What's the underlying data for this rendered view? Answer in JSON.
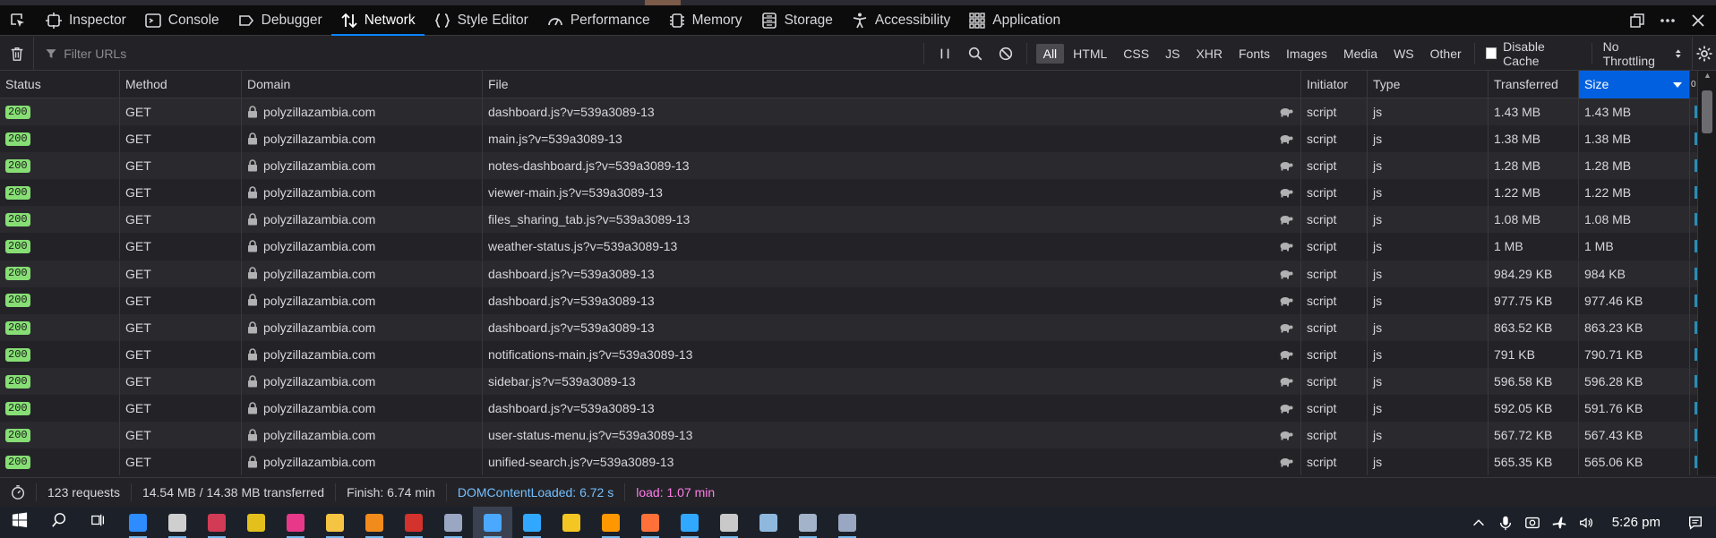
{
  "toolbar": {
    "tabs": [
      {
        "label": "Inspector",
        "icon": "inspector-icon"
      },
      {
        "label": "Console",
        "icon": "console-icon"
      },
      {
        "label": "Debugger",
        "icon": "debugger-icon"
      },
      {
        "label": "Network",
        "icon": "network-icon",
        "selected": true
      },
      {
        "label": "Style Editor",
        "icon": "style-editor-icon"
      },
      {
        "label": "Performance",
        "icon": "performance-icon"
      },
      {
        "label": "Memory",
        "icon": "memory-icon"
      },
      {
        "label": "Storage",
        "icon": "storage-icon"
      },
      {
        "label": "Accessibility",
        "icon": "accessibility-icon"
      },
      {
        "label": "Application",
        "icon": "application-icon"
      }
    ]
  },
  "filterbar": {
    "placeholder": "Filter URLs",
    "types": [
      "All",
      "HTML",
      "CSS",
      "JS",
      "XHR",
      "Fonts",
      "Images",
      "Media",
      "WS",
      "Other"
    ],
    "active_type": "All",
    "disable_cache_label": "Disable Cache",
    "throttling_label": "No Throttling"
  },
  "columns": {
    "status": "Status",
    "method": "Method",
    "domain": "Domain",
    "file": "File",
    "initiator": "Initiator",
    "type": "Type",
    "transferred": "Transferred",
    "size": "Size",
    "waterfall": "0"
  },
  "requests": [
    {
      "status": "200",
      "method": "GET",
      "domain": "polyzillazambia.com",
      "file": "dashboard.js?v=539a3089-13",
      "initiator": "script",
      "type": "js",
      "transferred": "1.43 MB",
      "size": "1.43 MB"
    },
    {
      "status": "200",
      "method": "GET",
      "domain": "polyzillazambia.com",
      "file": "main.js?v=539a3089-13",
      "initiator": "script",
      "type": "js",
      "transferred": "1.38 MB",
      "size": "1.38 MB"
    },
    {
      "status": "200",
      "method": "GET",
      "domain": "polyzillazambia.com",
      "file": "notes-dashboard.js?v=539a3089-13",
      "initiator": "script",
      "type": "js",
      "transferred": "1.28 MB",
      "size": "1.28 MB"
    },
    {
      "status": "200",
      "method": "GET",
      "domain": "polyzillazambia.com",
      "file": "viewer-main.js?v=539a3089-13",
      "initiator": "script",
      "type": "js",
      "transferred": "1.22 MB",
      "size": "1.22 MB"
    },
    {
      "status": "200",
      "method": "GET",
      "domain": "polyzillazambia.com",
      "file": "files_sharing_tab.js?v=539a3089-13",
      "initiator": "script",
      "type": "js",
      "transferred": "1.08 MB",
      "size": "1.08 MB"
    },
    {
      "status": "200",
      "method": "GET",
      "domain": "polyzillazambia.com",
      "file": "weather-status.js?v=539a3089-13",
      "initiator": "script",
      "type": "js",
      "transferred": "1 MB",
      "size": "1 MB"
    },
    {
      "status": "200",
      "method": "GET",
      "domain": "polyzillazambia.com",
      "file": "dashboard.js?v=539a3089-13",
      "initiator": "script",
      "type": "js",
      "transferred": "984.29 KB",
      "size": "984 KB"
    },
    {
      "status": "200",
      "method": "GET",
      "domain": "polyzillazambia.com",
      "file": "dashboard.js?v=539a3089-13",
      "initiator": "script",
      "type": "js",
      "transferred": "977.75 KB",
      "size": "977.46 KB"
    },
    {
      "status": "200",
      "method": "GET",
      "domain": "polyzillazambia.com",
      "file": "dashboard.js?v=539a3089-13",
      "initiator": "script",
      "type": "js",
      "transferred": "863.52 KB",
      "size": "863.23 KB"
    },
    {
      "status": "200",
      "method": "GET",
      "domain": "polyzillazambia.com",
      "file": "notifications-main.js?v=539a3089-13",
      "initiator": "script",
      "type": "js",
      "transferred": "791 KB",
      "size": "790.71 KB"
    },
    {
      "status": "200",
      "method": "GET",
      "domain": "polyzillazambia.com",
      "file": "sidebar.js?v=539a3089-13",
      "initiator": "script",
      "type": "js",
      "transferred": "596.58 KB",
      "size": "596.28 KB"
    },
    {
      "status": "200",
      "method": "GET",
      "domain": "polyzillazambia.com",
      "file": "dashboard.js?v=539a3089-13",
      "initiator": "script",
      "type": "js",
      "transferred": "592.05 KB",
      "size": "591.76 KB"
    },
    {
      "status": "200",
      "method": "GET",
      "domain": "polyzillazambia.com",
      "file": "user-status-menu.js?v=539a3089-13",
      "initiator": "script",
      "type": "js",
      "transferred": "567.72 KB",
      "size": "567.43 KB"
    },
    {
      "status": "200",
      "method": "GET",
      "domain": "polyzillazambia.com",
      "file": "unified-search.js?v=539a3089-13",
      "initiator": "script",
      "type": "js",
      "transferred": "565.35 KB",
      "size": "565.06 KB"
    }
  ],
  "summary": {
    "requests": "123 requests",
    "transferred": "14.54 MB / 14.38 MB transferred",
    "finish": "Finish: 6.74 min",
    "domcontentloaded": "DOMContentLoaded: 6.72 s",
    "load": "load: 1.07 min"
  },
  "taskbar": {
    "apps": [
      {
        "icon": "windows-start-icon",
        "color": "#ffffff"
      },
      {
        "icon": "search-icon",
        "color": "#ffffff"
      },
      {
        "icon": "task-view-icon",
        "color": "#ffffff"
      },
      {
        "icon": "zoom-icon",
        "color": "#2d8cff"
      },
      {
        "icon": "chrome-like-icon",
        "color": "#cfcfcf"
      },
      {
        "icon": "media-app-icon",
        "color": "#d23b55"
      },
      {
        "icon": "colorful-app-icon",
        "color": "#e3c01c"
      },
      {
        "icon": "pink-app-icon",
        "color": "#e8388a"
      },
      {
        "icon": "file-explorer-icon",
        "color": "#f6c443"
      },
      {
        "icon": "vlc-icon",
        "color": "#f18b1c"
      },
      {
        "icon": "red-circle-app-icon",
        "color": "#d4322c"
      },
      {
        "icon": "network-app-icon",
        "color": "#9aa7c2"
      },
      {
        "icon": "firefox-dev-icon",
        "color": "#4aa8ff",
        "active": true
      },
      {
        "icon": "photoshop-icon",
        "color": "#31a8ff"
      },
      {
        "icon": "emoji-app-icon",
        "color": "#f3c623"
      },
      {
        "icon": "sublime-icon",
        "color": "#ff9800"
      },
      {
        "icon": "firefox-icon",
        "color": "#ff7139"
      },
      {
        "icon": "photoshop-icon-2",
        "color": "#31a8ff"
      },
      {
        "icon": "archive-app-icon",
        "color": "#c9c9c9"
      },
      {
        "icon": "tools-app-icon",
        "color": "#8fb8de"
      },
      {
        "icon": "turtle-app-icon",
        "color": "#a3b3c9"
      },
      {
        "icon": "remote-app-icon",
        "color": "#9aa7c2"
      }
    ],
    "clock": "5:26 pm"
  }
}
